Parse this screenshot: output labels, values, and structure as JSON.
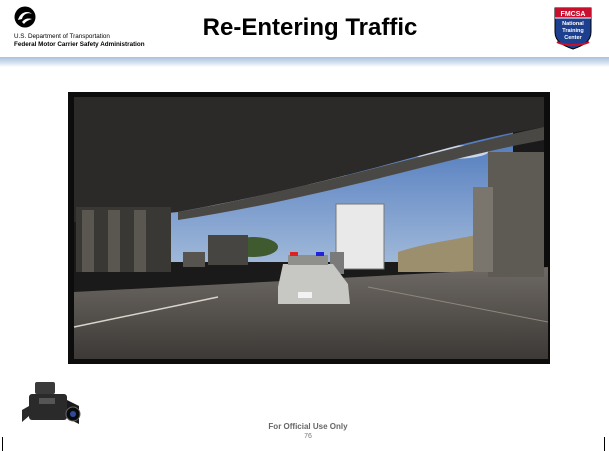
{
  "header": {
    "title": "Re-Entering Traffic",
    "dept_line": "U.S. Department of Transportation",
    "agency_line": "Federal Motor Carrier Safety Administration",
    "badge": {
      "top": "FMCSA",
      "middle": "National",
      "middle2": "Training",
      "bottom": "Center"
    }
  },
  "media": {
    "video_icon": "video-camera-icon"
  },
  "footer": {
    "classification": "For Official Use Only",
    "page_number": "76"
  },
  "colors": {
    "header_rule": "#a9c2df",
    "badge_red": "#c8102e",
    "badge_blue": "#1d3f8f",
    "sky": "#5f86c6"
  }
}
